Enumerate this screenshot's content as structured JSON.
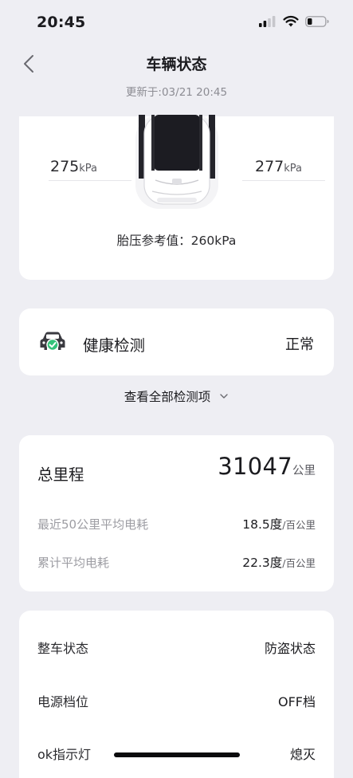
{
  "status_bar": {
    "time": "20:45"
  },
  "nav": {
    "title": "车辆状态",
    "updated": "更新于:03/21 20:45"
  },
  "tires": {
    "left": {
      "value": "275",
      "unit": "kPa"
    },
    "right": {
      "value": "277",
      "unit": "kPa"
    },
    "reference": "胎压参考值：260kPa"
  },
  "health": {
    "label": "健康检测",
    "status": "正常",
    "icon": "car-check-icon"
  },
  "view_all": {
    "label": "查看全部检测项",
    "icon": "chevron-down-icon"
  },
  "mileage": {
    "label": "总里程",
    "value": "31047",
    "unit": "公里",
    "rows": [
      {
        "label": "最近50公里平均电耗",
        "value": "18.5度",
        "unit": "/百公里"
      },
      {
        "label": "累计平均电耗",
        "value": "22.3度",
        "unit": "/百公里"
      }
    ]
  },
  "vehicle_state": {
    "rows": [
      {
        "label": "整车状态",
        "value": "防盗状态"
      },
      {
        "label": "电源档位",
        "value": "OFF档"
      },
      {
        "label": "ok指示灯",
        "value": "熄灭"
      }
    ]
  },
  "colors": {
    "background": "#eeeef3",
    "card": "#ffffff",
    "check_green": "#34c27a",
    "car_dark": "#3a3a40"
  }
}
